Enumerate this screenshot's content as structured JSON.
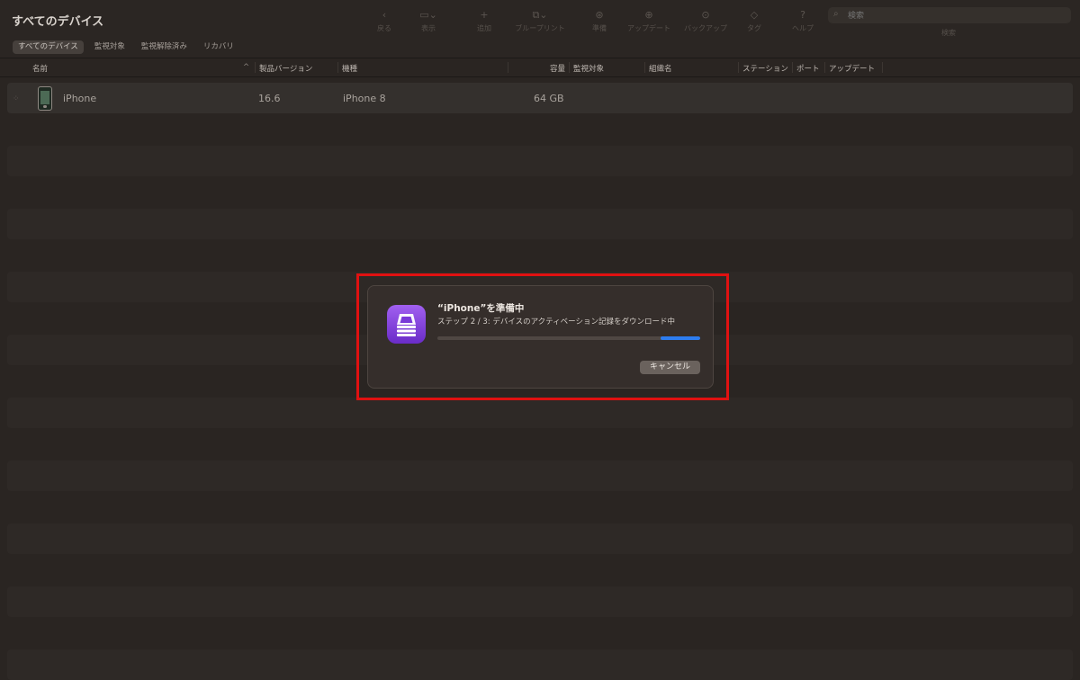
{
  "window": {
    "title": "すべてのデバイス"
  },
  "filters": [
    {
      "label": "すべてのデバイス",
      "active": true
    },
    {
      "label": "監視対象",
      "active": false
    },
    {
      "label": "監視解除済み",
      "active": false
    },
    {
      "label": "リカバリ",
      "active": false
    }
  ],
  "toolbar": {
    "back": "戻る",
    "view": "表示",
    "add": "追加",
    "blueprint": "ブループリント",
    "prepare": "準備",
    "update": "アップデート",
    "backup": "バックアップ",
    "tag": "タグ",
    "help": "ヘルプ"
  },
  "search": {
    "placeholder": "検索",
    "caption": "検索"
  },
  "columns": {
    "name": "名前",
    "version": "製品バージョン",
    "model": "機種",
    "capacity": "容量",
    "supervised": "監視対象",
    "org": "組織名",
    "station": "ステーション",
    "port": "ポート",
    "update": "アップデート"
  },
  "devices": [
    {
      "name": "iPhone",
      "version": "16.6",
      "model": "iPhone 8",
      "capacity": "64 GB"
    }
  ],
  "dialog": {
    "title": "“iPhone”を準備中",
    "step": "ステップ 2 / 3: デバイスのアクティベーション記録をダウンロード中",
    "progress": 0.15,
    "cancel_label": "キャンセル"
  },
  "colors": {
    "accent": "#2d7df0",
    "highlight": "#e01111",
    "app_icon": "#8a45e6"
  }
}
